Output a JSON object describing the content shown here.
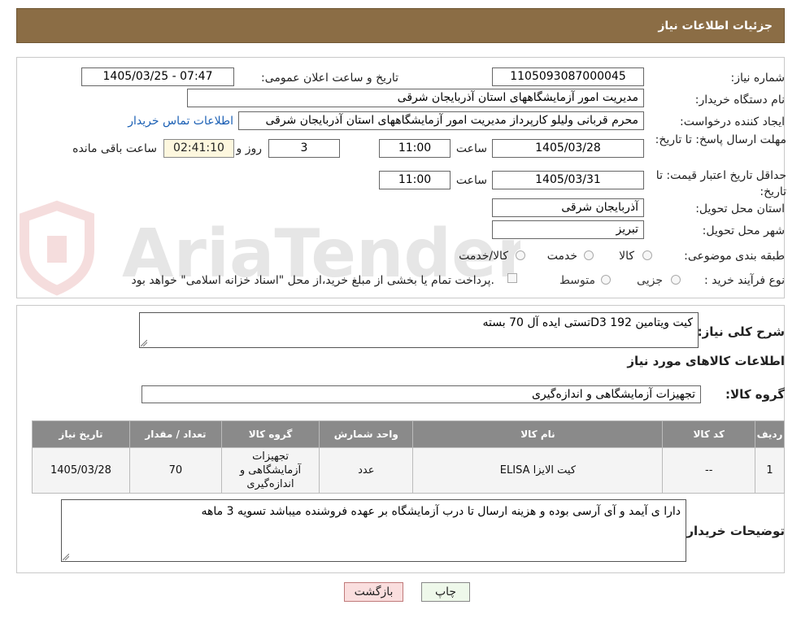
{
  "header": {
    "title": "جزئیات اطلاعات نیاز"
  },
  "form": {
    "need_number_label": "شماره نیاز:",
    "need_number": "1105093087000045",
    "announce_label": "تاریخ و ساعت اعلان عمومی:",
    "announce_value": "1405/03/25 - 07:47",
    "buyer_org_label": "نام دستگاه خریدار:",
    "buyer_org": "مدیریت امور آزمایشگاههای استان آذربایجان شرقی",
    "creator_label": "ایجاد کننده درخواست:",
    "creator": "محرم قربانی ولیلو کارپرداز مدیریت امور آزمایشگاههای استان آذربایجان شرقی",
    "contact_link": "اطلاعات تماس خریدار",
    "reply_deadline_label": "مهلت ارسال پاسخ: تا تاریخ:",
    "reply_date": "1405/03/28",
    "time_label": "ساعت",
    "reply_time": "11:00",
    "days_value": "3",
    "days_label": "روز و",
    "remaining_time": "02:41:10",
    "remaining_label": "ساعت باقی مانده",
    "validity_label": "حداقل تاریخ اعتبار قیمت: تا تاریخ:",
    "validity_date": "1405/03/31",
    "validity_time": "11:00",
    "province_label": "استان محل تحویل:",
    "province": "آذربایجان شرقی",
    "city_label": "شهر محل تحویل:",
    "city": "تبریز",
    "category_label": "طبقه بندی موضوعی:",
    "category_options": [
      "کالا",
      "خدمت",
      "کالا/خدمت"
    ],
    "process_label": "نوع فرآیند خرید :",
    "process_options": [
      "جزیی",
      "متوسط"
    ],
    "treasury_text": "پرداخت تمام یا بخشی از مبلغ خرید،از محل \"اسناد خزانه اسلامی\" خواهد بود."
  },
  "details": {
    "description_label": "شرح کلی نیاز:",
    "description": "کیت ویتامین D3 192تستی ایده آل 70 بسته",
    "goods_info_title": "اطلاعات کالاهای مورد نیاز",
    "goods_group_label": "گروه کالا:",
    "goods_group": "تجهیزات آزمایشگاهی و اندازه‌گیری",
    "table": {
      "headers": [
        "ردیف",
        "کد کالا",
        "نام کالا",
        "واحد شمارش",
        "گروه کالا",
        "تعداد / مقدار",
        "تاریخ نیاز"
      ],
      "rows": [
        [
          "1",
          "--",
          "کیت الایزا ELISA",
          "عدد",
          "تجهیزات آزمایشگاهی و اندازه‌گیری",
          "70",
          "1405/03/28"
        ]
      ]
    },
    "buyer_notes_label": "توضیحات خریدار:",
    "buyer_notes": "دارا ی آیمد و آی آرسی بوده و هزینه ارسال تا درب آزمایشگاه بر عهده فروشنده میباشد تسویه 3 ماهه"
  },
  "buttons": {
    "print": "چاپ",
    "back": "بازگشت"
  },
  "colors": {
    "header_bg": "#8b6d45",
    "table_header_bg": "#8a8a8a",
    "link": "#1a5fb4",
    "back_btn_bg": "#fadede",
    "print_btn_bg": "#eef8ea"
  }
}
